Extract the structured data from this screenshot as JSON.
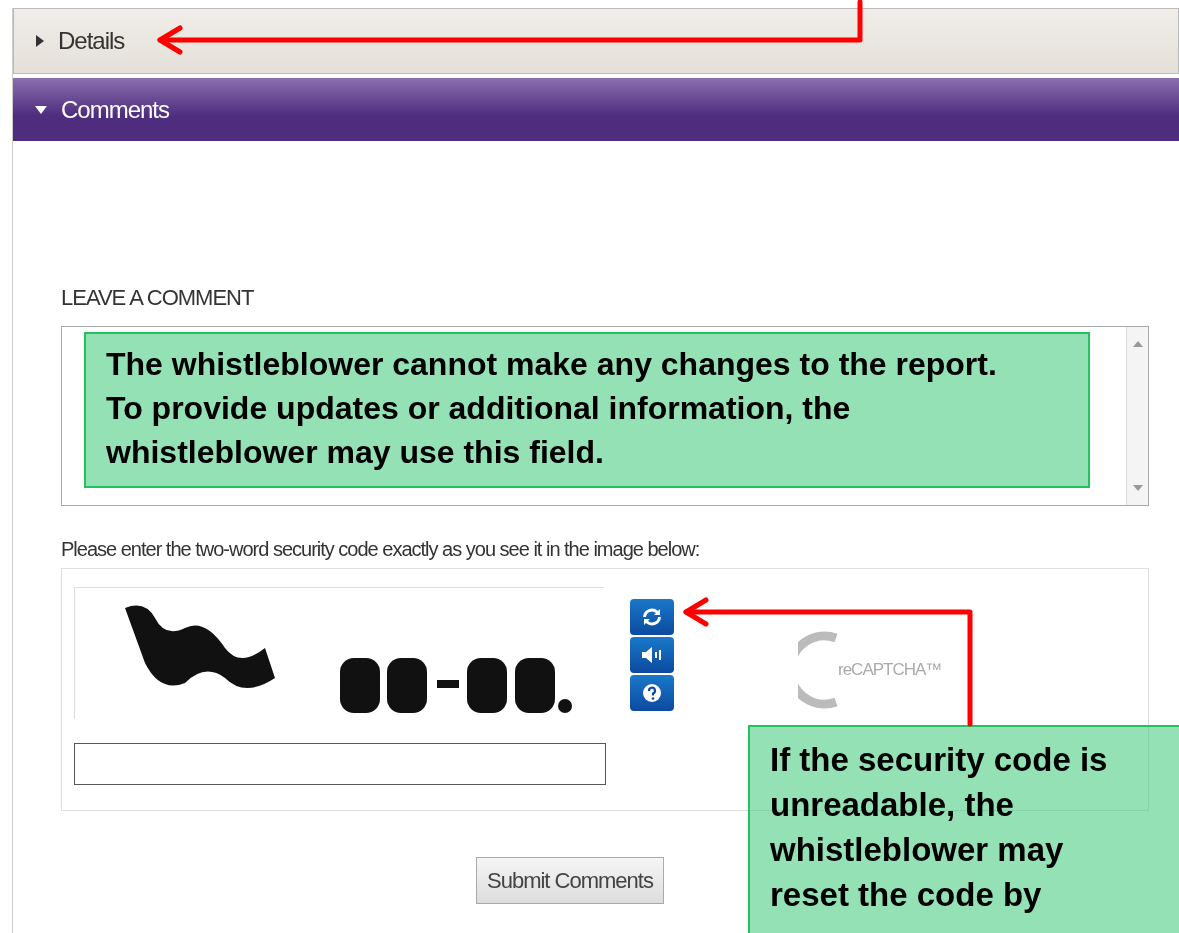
{
  "sections": [
    {
      "title": "Details",
      "expanded": false
    },
    {
      "title": "Comments",
      "expanded": true
    }
  ],
  "comment_form": {
    "heading": "LEAVE A COMMENT",
    "captcha_prompt": "Please enter the two-word security code exactly as you see it in the image below:",
    "captcha_logo": "reCAPTCHA™",
    "submit": "Submit Comments"
  },
  "annotations": [
    {
      "text": "The whistleblower cannot make any changes to the report. To provide updates or additional information, the whistleblower may use this field."
    },
    {
      "text": "If the security code is unreadable, the whistleblower may reset the code by"
    }
  ]
}
